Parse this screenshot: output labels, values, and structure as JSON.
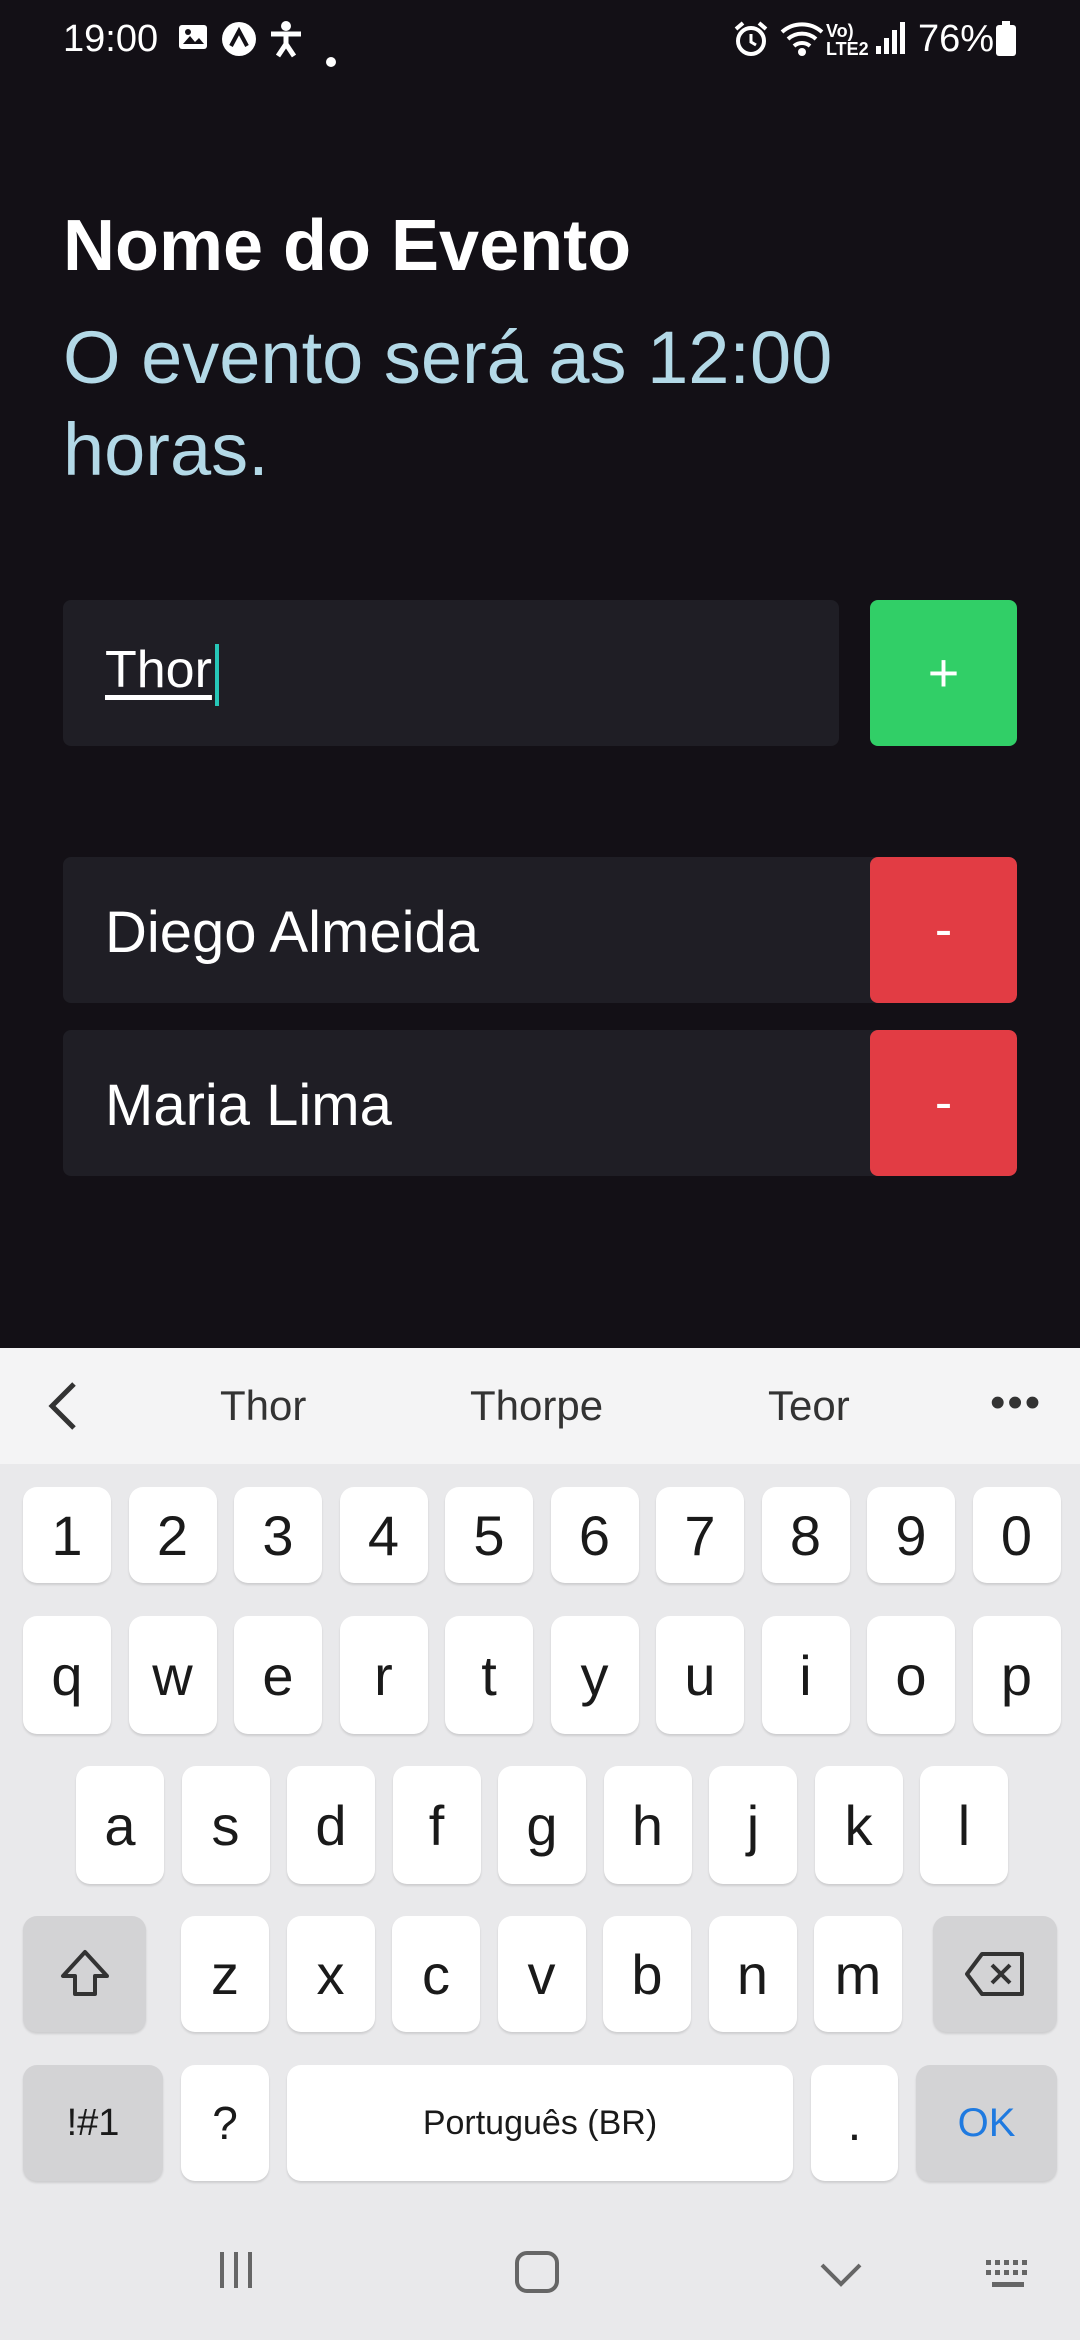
{
  "status_bar": {
    "time": "19:00",
    "battery": "76%",
    "icons": [
      "gallery-icon",
      "app-icon",
      "accessibility-icon",
      "dot-icon",
      "alarm-icon",
      "wifi-icon",
      "volte-icon",
      "signal-icon",
      "battery-icon"
    ]
  },
  "event": {
    "title": "Nome do Evento",
    "subtitle": "O evento será as 12:00 horas."
  },
  "input": {
    "value": "Thor",
    "add_label": "+"
  },
  "participants": [
    {
      "name": "Diego Almeida",
      "remove_label": "-"
    },
    {
      "name": "Maria Lima",
      "remove_label": "-"
    }
  ],
  "keyboard": {
    "suggestions": [
      "Thor",
      "Thorpe",
      "Teor"
    ],
    "more": "•••",
    "row_numbers": [
      "1",
      "2",
      "3",
      "4",
      "5",
      "6",
      "7",
      "8",
      "9",
      "0"
    ],
    "row1": [
      "q",
      "w",
      "e",
      "r",
      "t",
      "y",
      "u",
      "i",
      "o",
      "p"
    ],
    "row2": [
      "a",
      "s",
      "d",
      "f",
      "g",
      "h",
      "j",
      "k",
      "l"
    ],
    "row3": [
      "z",
      "x",
      "c",
      "v",
      "b",
      "n",
      "m"
    ],
    "symbols": "!#1",
    "question": "?",
    "space": "Português (BR)",
    "period": ".",
    "ok": "OK"
  },
  "colors": {
    "background": "#131016",
    "subtitle": "#b3d9e7",
    "add": "#31cf67",
    "remove": "#e23c44",
    "field": "#1f1e25"
  }
}
